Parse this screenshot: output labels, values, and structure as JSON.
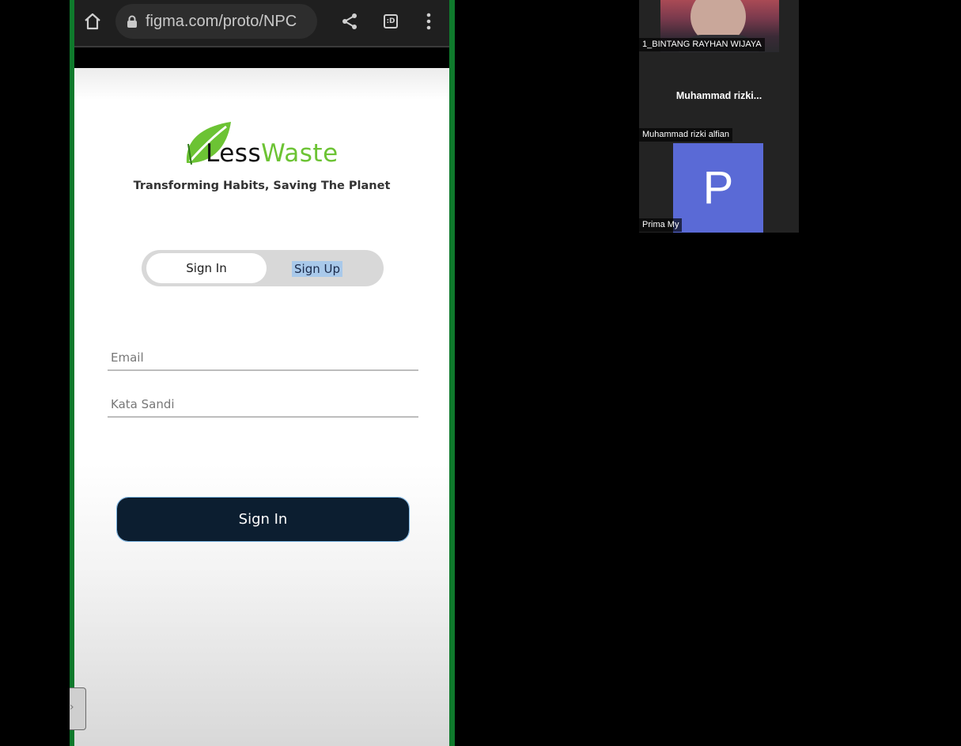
{
  "browser": {
    "url": "figma.com/proto/NPC",
    "tab_count_label": ":D"
  },
  "app": {
    "brand_less": "Less",
    "brand_waste": "Waste",
    "tagline": "Transforming Habits, Saving The Planet",
    "toggle": {
      "active": "Sign In",
      "inactive": "Sign Up"
    },
    "fields": {
      "email_placeholder": "Email",
      "password_placeholder": "Kata Sandi"
    },
    "submit_label": "Sign In"
  },
  "meeting": {
    "participants": [
      {
        "name": "1_BINTANG RAYHAN WIJAYA"
      },
      {
        "name": "Muhammad rizki alfian",
        "tile_title": "Muhammad  rizki..."
      },
      {
        "name": "Prima My",
        "initial": "P"
      }
    ]
  },
  "colors": {
    "brand_green": "#6cc334",
    "button_navy": "#0c1e30",
    "frame_green": "#0f7a2c",
    "avatar_purple": "#5a6ad6"
  }
}
